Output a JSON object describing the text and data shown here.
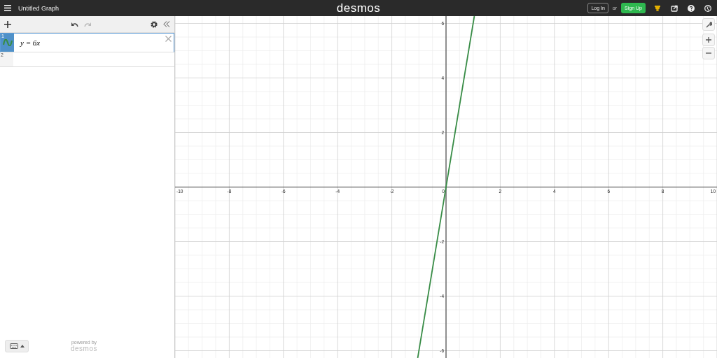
{
  "header": {
    "title": "Untitled Graph",
    "logo": "desmos",
    "login": "Log In",
    "or": "or",
    "signup": "Sign Up"
  },
  "expressions": [
    {
      "number": "1",
      "text": "y = 6x",
      "color": "#388c46",
      "selected": true
    },
    {
      "number": "2",
      "selected": false
    }
  ],
  "footer": {
    "powered": "powered by",
    "brand": "desmos"
  },
  "graph": {
    "chart_data": {
      "type": "line",
      "grid": true,
      "x": [
        -1.045,
        1.045
      ],
      "series": [
        {
          "color": "#388c46",
          "values": [
            -6.27,
            6.27
          ]
        }
      ],
      "xlim": [
        -10,
        10
      ],
      "ylim": [
        -6.27,
        6.27
      ],
      "xticks": [
        {
          "value": -10,
          "label": "-10"
        },
        {
          "value": -8,
          "label": "-8"
        },
        {
          "value": -6,
          "label": "-6"
        },
        {
          "value": -4,
          "label": "-4"
        },
        {
          "value": -2,
          "label": "-2"
        },
        {
          "value": 0,
          "label": "0"
        },
        {
          "value": 2,
          "label": "2"
        },
        {
          "value": 4,
          "label": "4"
        },
        {
          "value": 6,
          "label": "6"
        },
        {
          "value": 8,
          "label": "8"
        },
        {
          "value": 10,
          "label": "10"
        }
      ],
      "yticks": [
        {
          "value": -6,
          "label": "-6"
        },
        {
          "value": -4,
          "label": "-4"
        },
        {
          "value": -2,
          "label": "-2"
        },
        {
          "value": 2,
          "label": "2"
        },
        {
          "value": 4,
          "label": "4"
        },
        {
          "value": 6,
          "label": "6"
        }
      ]
    }
  }
}
